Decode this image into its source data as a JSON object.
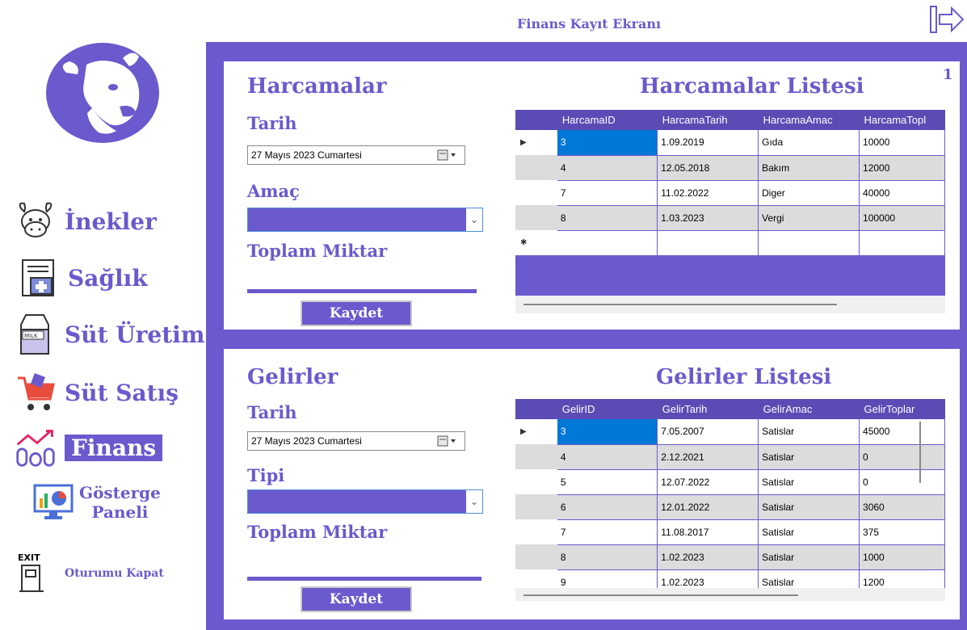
{
  "header": {
    "title": "Finans Kayıt Ekranı"
  },
  "sidebar": {
    "items": [
      {
        "label": "İnekler",
        "icon": "cow-face-icon"
      },
      {
        "label": "Sağlık",
        "icon": "medical-file-icon"
      },
      {
        "label": "Süt Üretim",
        "icon": "milk-carton-icon"
      },
      {
        "label": "Süt Satış",
        "icon": "shopping-cart-icon"
      },
      {
        "label": "Finans",
        "icon": "finance-chart-icon",
        "active": true
      },
      {
        "label": "Gösterge Paneli",
        "label_line1": "Gösterge",
        "label_line2": "Paneli",
        "icon": "dashboard-chart-icon"
      },
      {
        "label": "Oturumu Kapat",
        "icon": "exit-door-icon",
        "icon_text": "EXIT"
      }
    ]
  },
  "expenses": {
    "title": "Harcamalar",
    "date_label": "Tarih",
    "date_value": "27  Mayıs   2023 Cumartesi",
    "purpose_label": "Amaç",
    "purpose_value": "",
    "total_label": "Toplam Miktar",
    "save_label": "Kaydet",
    "list_title": "Harcamalar Listesi",
    "page_indicator": "1",
    "columns": [
      "HarcamaID",
      "HarcamaTarih",
      "HarcamaAmac",
      "HarcamaTopl"
    ],
    "rows": [
      [
        "3",
        "1.09.2019",
        "Gıda",
        "10000"
      ],
      [
        "4",
        "12.05.2018",
        "Bakım",
        "12000"
      ],
      [
        "7",
        "11.02.2022",
        "Diger",
        "40000"
      ],
      [
        "8",
        "1.03.2023",
        "Vergi",
        "100000"
      ],
      [
        "",
        "",
        "",
        ""
      ]
    ]
  },
  "income": {
    "title": "Gelirler",
    "date_label": "Tarih",
    "date_value": "27  Mayıs   2023 Cumartesi",
    "type_label": "Tipi",
    "type_value": "",
    "total_label": "Toplam Miktar",
    "save_label": "Kaydet",
    "list_title": "Gelirler Listesi",
    "columns": [
      "GelirID",
      "GelirTarih",
      "GelirAmac",
      "GelirToplar"
    ],
    "rows": [
      [
        "3",
        "7.05.2007",
        "Satislar",
        "45000"
      ],
      [
        "4",
        "2.12.2021",
        "Satislar",
        "0"
      ],
      [
        "5",
        "12.07.2022",
        "Satislar",
        "0"
      ],
      [
        "6",
        "12.01.2022",
        "Satislar",
        "3060"
      ],
      [
        "7",
        "11.08.2017",
        "Satislar",
        "375"
      ],
      [
        "8",
        "1.02.2023",
        "Satislar",
        "1000"
      ],
      [
        "9",
        "1.02.2023",
        "Satislar",
        "1200"
      ]
    ]
  },
  "colors": {
    "accent": "#6a5acd",
    "header_dark": "#5a4bb5",
    "selection": "#0078d7"
  }
}
